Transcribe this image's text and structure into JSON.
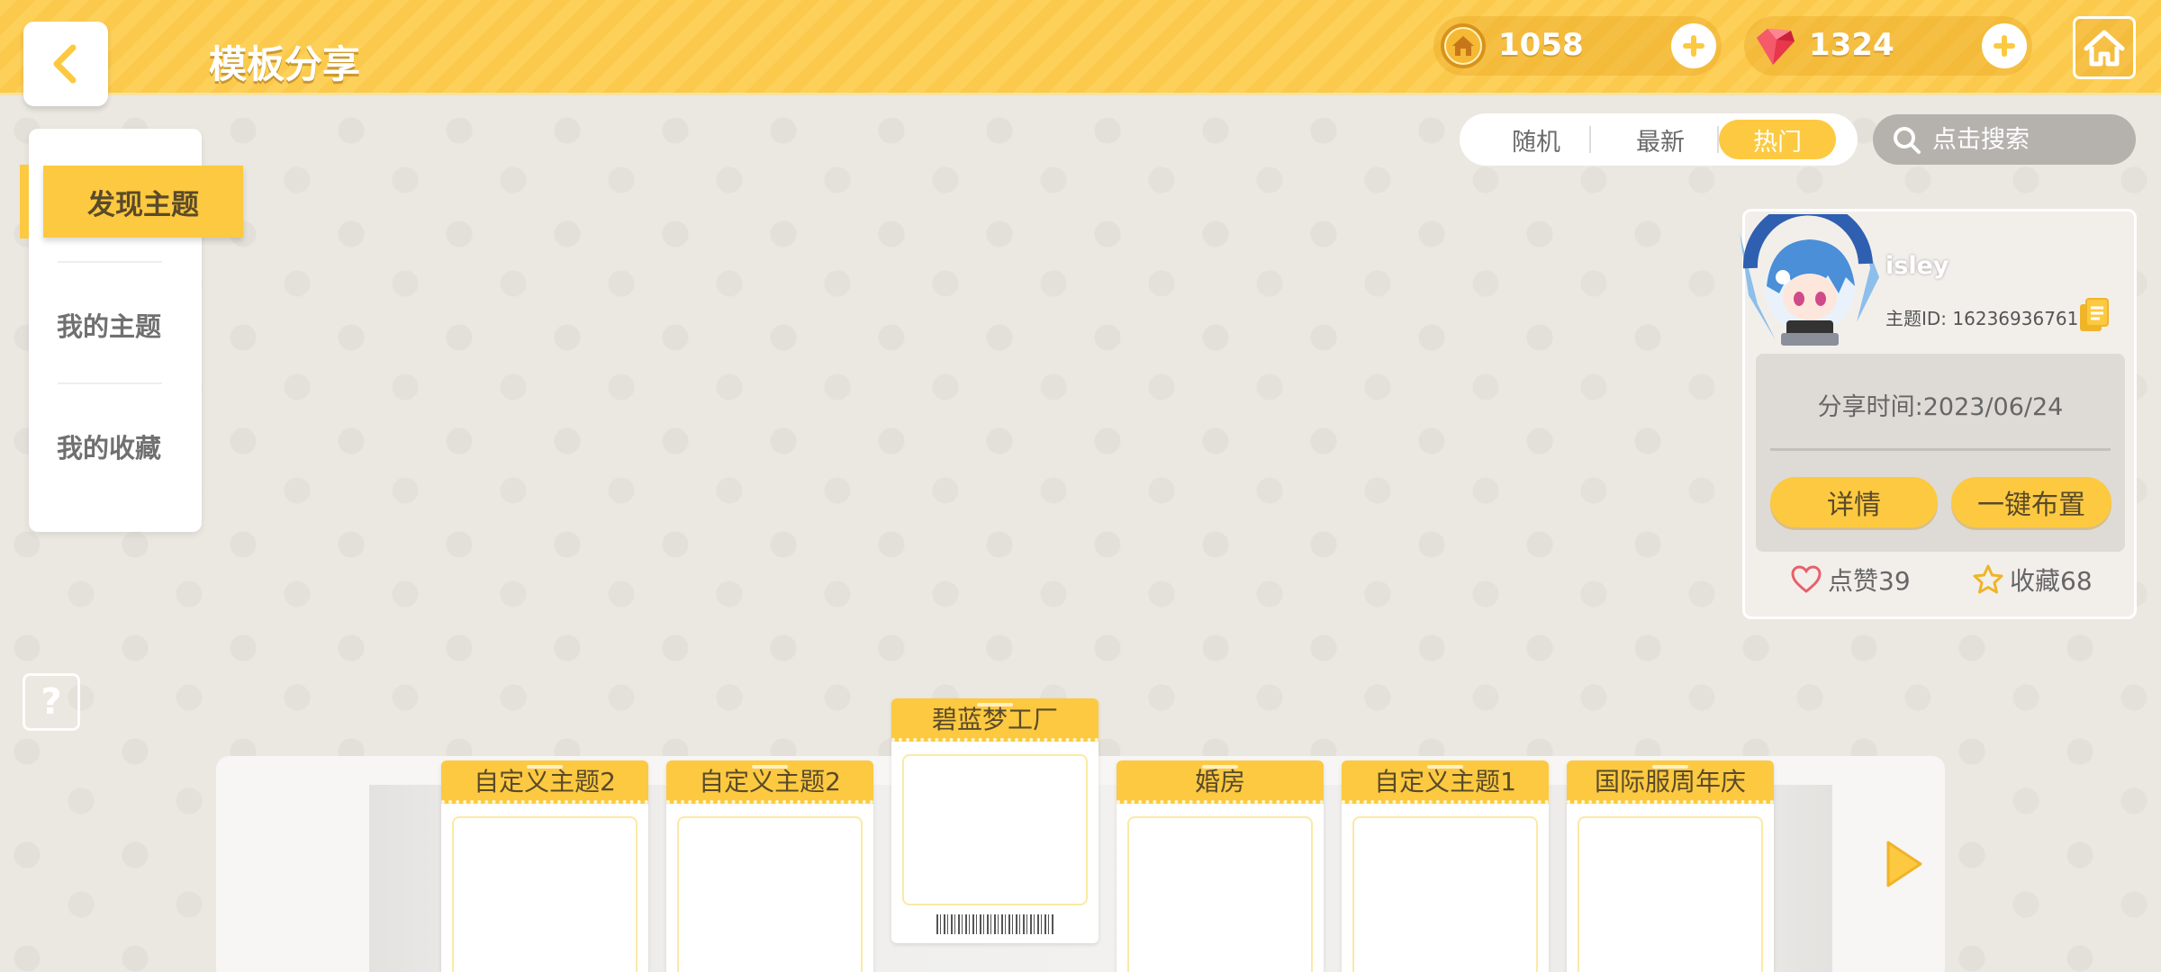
{
  "header": {
    "title": "模板分享",
    "coins": "1058",
    "gems": "1324"
  },
  "left_menu": {
    "items": [
      {
        "label": "发现主题",
        "active": true
      },
      {
        "label": "我的主题",
        "active": false
      },
      {
        "label": "我的收藏",
        "active": false
      }
    ]
  },
  "help": {
    "label": "?"
  },
  "sort": {
    "tabs": [
      {
        "label": "随机",
        "active": false
      },
      {
        "label": "最新",
        "active": false
      },
      {
        "label": "热门",
        "active": true
      }
    ]
  },
  "search": {
    "placeholder": "点击搜索"
  },
  "detail": {
    "username": "isley",
    "theme_id": "主题ID: 16236936761",
    "share_time": "分享时间:2023/06/24",
    "detail_button": "详情",
    "apply_button": "一键布置",
    "likes": "点赞39",
    "favorites": "收藏68"
  },
  "carousel": {
    "cards": [
      {
        "title": "自定义主题2",
        "selected": false
      },
      {
        "title": "自定义主题2",
        "selected": false
      },
      {
        "title": "碧蓝梦工厂",
        "selected": true
      },
      {
        "title": "婚房",
        "selected": false
      },
      {
        "title": "自定义主题1",
        "selected": false
      },
      {
        "title": "国际服周年庆",
        "selected": false
      }
    ]
  },
  "colors": {
    "accent": "#fcc940",
    "background": "#ebe7e1",
    "gem": "#e8364a"
  },
  "icons": [
    "back-arrow-icon",
    "coin-icon",
    "gem-icon",
    "plus-icon",
    "home-icon",
    "search-icon",
    "copy-icon",
    "heart-icon",
    "star-icon",
    "next-arrow-icon"
  ]
}
